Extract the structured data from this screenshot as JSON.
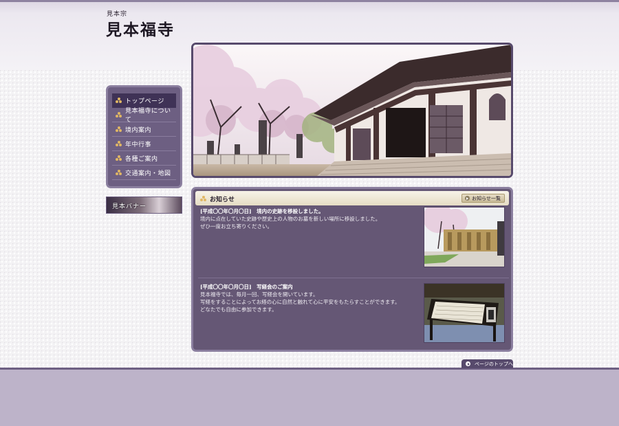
{
  "site": {
    "subtitle": "見本宗",
    "title": "見本福寺"
  },
  "nav": {
    "items": [
      {
        "label": "トップページ",
        "active": true
      },
      {
        "label": "見本福寺について",
        "active": false
      },
      {
        "label": "境内案内",
        "active": false
      },
      {
        "label": "年中行事",
        "active": false
      },
      {
        "label": "各種ご案内",
        "active": false
      },
      {
        "label": "交通案内・地図",
        "active": false
      }
    ]
  },
  "banner": {
    "label": "見本バナー"
  },
  "news": {
    "heading": "お知らせ",
    "list_button": "お知らせ一覧",
    "items": [
      {
        "title": "[平成〇〇年〇月〇日]　境内の史跡を移設しました。",
        "lines": [
          "境内に点在していた史跡や歴史上の人物のお墓を新しい場所に移設しました。",
          "ぜひ一度お立ち寄りください。"
        ]
      },
      {
        "title": "[平成〇〇年〇月〇日]　写経会のご案内",
        "lines": [
          "見本福寺では、毎月一回、写経会を開いています。",
          "写経をすることによってお経の心に自然と触れて心に平安をもたらすことができます。",
          "どなたでも自由に参加できます。"
        ]
      }
    ]
  },
  "page_top": {
    "label": "ページのトップへ"
  },
  "icons": {
    "bullet": "trefoil-icon",
    "arrow": "arrow-circle-icon"
  },
  "colors": {
    "primary": "#6d5f82",
    "dark": "#574a6c",
    "panel": "#655775",
    "accent": "#e0b764",
    "footer": "#bdb3c9"
  }
}
